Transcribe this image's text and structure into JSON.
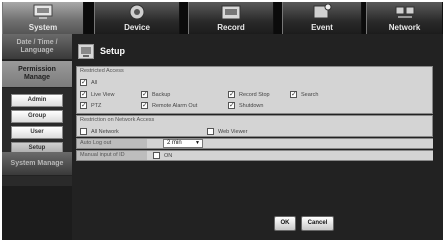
{
  "top_tabs": [
    {
      "label": "System",
      "icon": "system-icon",
      "active": true
    },
    {
      "label": "Device",
      "icon": "device-icon",
      "active": false
    },
    {
      "label": "Record",
      "icon": "record-icon",
      "active": false
    },
    {
      "label": "Event",
      "icon": "event-icon",
      "active": false
    },
    {
      "label": "Network",
      "icon": "network-icon",
      "active": false
    }
  ],
  "side_categories": {
    "date": "Date / Time / Language",
    "permission": "Permission Manage",
    "system": "System Manage"
  },
  "side_subitems": [
    "Admin",
    "Group",
    "User",
    "Setup"
  ],
  "selected_subitem": "Setup",
  "page": {
    "title": "Setup"
  },
  "restricted_access": {
    "title": "Restricted Access",
    "options": {
      "all": {
        "label": "All",
        "checked": true
      },
      "live_view": {
        "label": "Live View",
        "checked": true
      },
      "backup": {
        "label": "Backup",
        "checked": true
      },
      "record_stop": {
        "label": "Record Stop",
        "checked": true
      },
      "search": {
        "label": "Search",
        "checked": true
      },
      "ptz": {
        "label": "PTZ",
        "checked": true
      },
      "remote_alarm_out": {
        "label": "Remote Alarm Out",
        "checked": true
      },
      "shutdown": {
        "label": "Shutdown",
        "checked": true
      }
    }
  },
  "network_access": {
    "title": "Restriction on Network Access",
    "options": {
      "all_network": {
        "label": "All Network",
        "checked": false
      },
      "web_viewer": {
        "label": "Web Viewer",
        "checked": false
      }
    }
  },
  "auto_log_out": {
    "label": "Auto Log out",
    "value": "2 min"
  },
  "manual_input": {
    "label": "Manual input of ID",
    "option_label": "ON",
    "checked": false
  },
  "buttons": {
    "ok": "OK",
    "cancel": "Cancel"
  },
  "colors": {
    "tab_bar": "#0b0b0b",
    "content_bg": "#222222",
    "panel_bg": "#d4d4d4"
  }
}
